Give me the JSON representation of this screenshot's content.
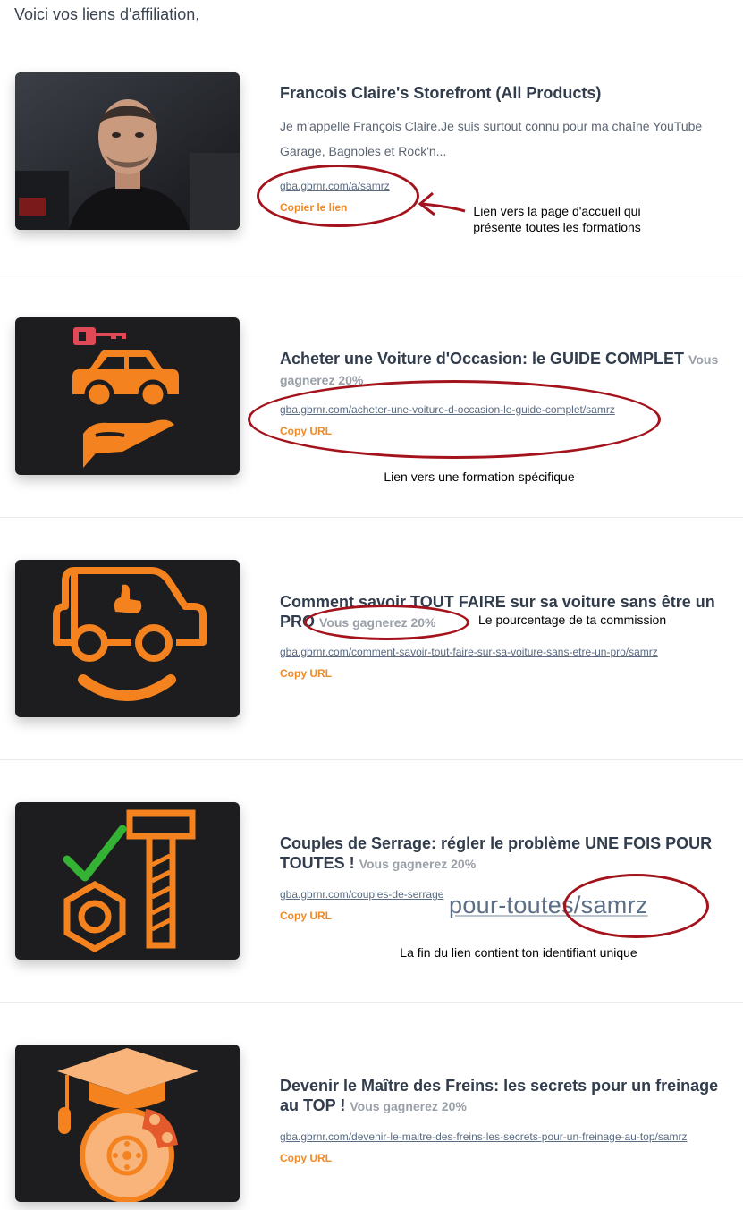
{
  "intro": "Voici vos liens d'affiliation,",
  "products": [
    {
      "title": "Francois Claire's Storefront (All Products)",
      "description": "Je m'appelle François Claire.Je suis surtout connu pour ma chaîne YouTube Garage, Bagnoles et Rock'n...",
      "url": "gba.gbrnr.com/a/samrz",
      "copy_label": "Copier le lien"
    },
    {
      "title": "Acheter une Voiture d'Occasion: le GUIDE COMPLET",
      "commission": "Vous gagnerez 20%",
      "url": "gba.gbrnr.com/acheter-une-voiture-d-occasion-le-guide-complet/samrz",
      "copy_label": "Copy URL"
    },
    {
      "title": "Comment savoir TOUT FAIRE sur sa voiture sans être un PRO",
      "commission": "Vous gagnerez 20%",
      "url": "gba.gbrnr.com/comment-savoir-tout-faire-sur-sa-voiture-sans-etre-un-pro/samrz",
      "copy_label": "Copy URL"
    },
    {
      "title": "Couples de Serrage: régler le problème UNE FOIS POUR TOUTES !",
      "commission": "Vous gagnerez 20%",
      "url": "gba.gbrnr.com/couples-de-serrage",
      "copy_label": "Copy URL"
    },
    {
      "title": "Devenir le Maître des Freins: les secrets pour un freinage au TOP !",
      "commission": "Vous gagnerez 20%",
      "url": "gba.gbrnr.com/devenir-le-maitre-des-freins-les-secrets-pour-un-freinage-au-top/samrz",
      "copy_label": "Copy URL"
    }
  ],
  "annotations": {
    "storefront_line1": "Lien vers la page d'accueil qui",
    "storefront_line2": "présente toutes les formations",
    "specific": "Lien vers une formation spécifique",
    "commission": "Le pourcentage de ta commission",
    "zoom_text": "pour-toutes/samrz",
    "identifier": "La fin du lien contient ton identifiant unique"
  },
  "colors": {
    "accent_orange": "#f08a24",
    "annotation_red": "#a4121c",
    "thumb_bg": "#1d1d1f"
  }
}
